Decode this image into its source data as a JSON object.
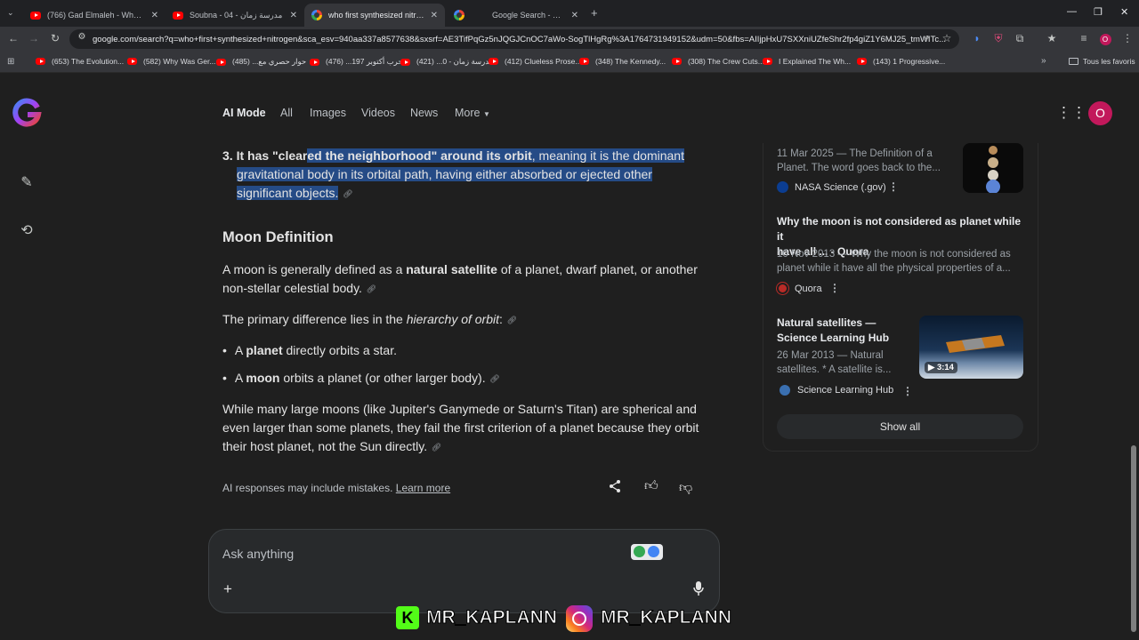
{
  "tabs": [
    {
      "title": "(766) Gad Elmaleh - Where is B",
      "icon": "youtube-icon"
    },
    {
      "title": "مدرسة زمان - 04 - Soubna",
      "icon": "youtube-icon"
    },
    {
      "title": "who first synthesized nitrogen",
      "icon": "google-icon"
    },
    {
      "title": "Google Search - المصمم",
      "icon": "google-icon"
    }
  ],
  "address": "google.com/search?q=who+first+synthesized+nitrogen&sca_esv=940aa337a8577638&sxsrf=AE3TifPqGz5nJQGJCnOC7aWo-SogTlHgRg%3A1764731949152&udm=50&fbs=AIIjpHxU7SXXniUZfeShr2fp4giZ1Y6MJ25_tmWITc...",
  "bookmarks": [
    "(653) The Evolution...",
    "(582) Why Was Ger...",
    "حوار حصري مع... (485)",
    "حرب أكتوبر 197... (476)",
    "مدرسة زمان - 0... (421)",
    "(412) Clueless Prose...",
    "(348) The Kennedy...",
    "(308) The Crew Cuts...",
    "I Explained The Wh...",
    "(143) 1 Progressive..."
  ],
  "bookmarks_all": "Tous les favoris",
  "nav": {
    "ai_mode": "AI Mode",
    "all": "All",
    "images": "Images",
    "videos": "Videos",
    "news": "News",
    "more": "More"
  },
  "avatar_letter": "O",
  "answer": {
    "item3_num": "3.",
    "item3_pre": "It has \"clear",
    "item3_hl_bold": "ed the neighborhood\" around its orbit",
    "item3_hl_rest": ", meaning it is the dominant",
    "item3_line2": "gravitational body in its orbital path, having either absorbed or ejected other",
    "item3_line3": "significant objects.",
    "moon_heading": "Moon Definition",
    "moon_p1_a": "A moon is generally defined as a ",
    "moon_p1_bold": "natural satellite",
    "moon_p1_b": " of a planet, dwarf planet, or another",
    "moon_p1_line2": "non-stellar celestial body.",
    "moon_p2_a": "The primary difference lies in the ",
    "moon_p2_italic": "hierarchy of orbit",
    "moon_p2_b": ":",
    "bullet1_a": "A ",
    "bullet1_bold": "planet",
    "bullet1_b": " directly orbits a star.",
    "bullet2_a": "A ",
    "bullet2_bold": "moon",
    "bullet2_b": " orbits a planet (or other larger body).",
    "para_line1": "While many large moons (like Jupiter's Ganymede or Saturn's Titan) are spherical and",
    "para_line2": "even larger than some planets, they fail the first criterion of a planet because they orbit",
    "para_line3": "their host planet, not the Sun directly.",
    "disclaimer": "AI responses may include mistakes.",
    "learn_more": "Learn more"
  },
  "sources": [
    {
      "snippet_line1": "11 Mar 2025 — The Definition of a",
      "snippet_line2": "Planet. The word goes back to the...",
      "site": "NASA Science (.gov)"
    },
    {
      "title_line1": "Why the moon is not considered as planet while it",
      "title_line2": "have all ... - Quora",
      "snippet_line1": "10 Nov 2013 — Why the moon is not considered as",
      "snippet_line2": "planet while it have all the physical properties of a...",
      "site": "Quora"
    },
    {
      "title_line1": "Natural satellites —",
      "title_line2": "Science Learning Hub",
      "snippet_line1": "26 Mar 2013 — Natural",
      "snippet_line2": "satellites. * A satellite is...",
      "site": "Science Learning Hub",
      "duration": "3:14"
    }
  ],
  "show_all": "Show all",
  "ask_placeholder": "Ask anything",
  "watermark": {
    "handle1": "MR_KAPLANN",
    "handle2": "MR_KAPLANN"
  }
}
